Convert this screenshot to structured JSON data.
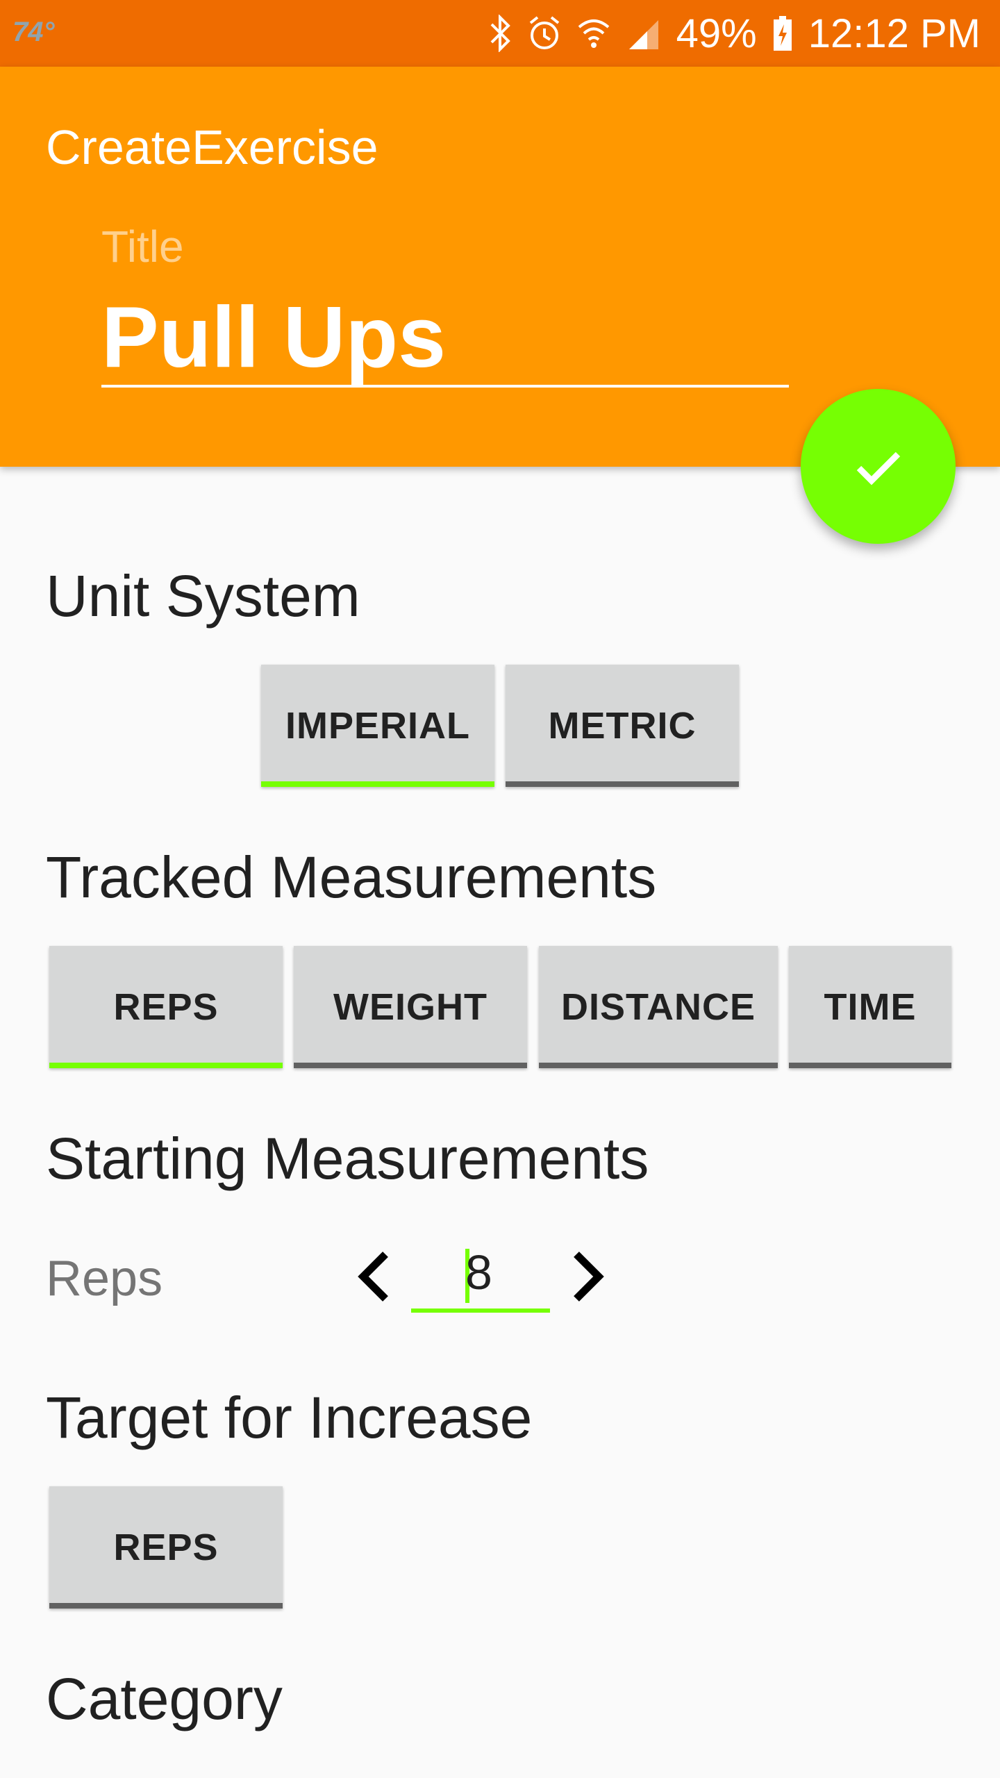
{
  "status_bar": {
    "temperature": "74°",
    "battery": "49%",
    "time": "12:12 PM",
    "icons": [
      "bluetooth-icon",
      "alarm-icon",
      "wifi-icon",
      "signal-icon",
      "battery-charging-icon"
    ]
  },
  "app_bar": {
    "title": "CreateExercise",
    "title_field_label": "Title",
    "title_field_value": "Pull Ups"
  },
  "fab": {
    "icon": "check-icon",
    "color": "#76ff03"
  },
  "unit_system": {
    "heading": "Unit System",
    "options": [
      "IMPERIAL",
      "METRIC"
    ],
    "selected": "IMPERIAL"
  },
  "tracked": {
    "heading": "Tracked Measurements",
    "options": [
      "REPS",
      "WEIGHT",
      "DISTANCE",
      "TIME"
    ],
    "selected": "REPS"
  },
  "starting": {
    "heading": "Starting Measurements",
    "label": "Reps",
    "value": "8"
  },
  "target": {
    "heading": "Target for Increase",
    "options": [
      "REPS"
    ]
  },
  "category": {
    "heading": "Category"
  },
  "colors": {
    "status_bar": "#ef6c00",
    "app_bar": "#ff9800",
    "accent": "#76ff03",
    "toggle_bg": "#d6d7d7",
    "toggle_off_bar": "#616161"
  }
}
